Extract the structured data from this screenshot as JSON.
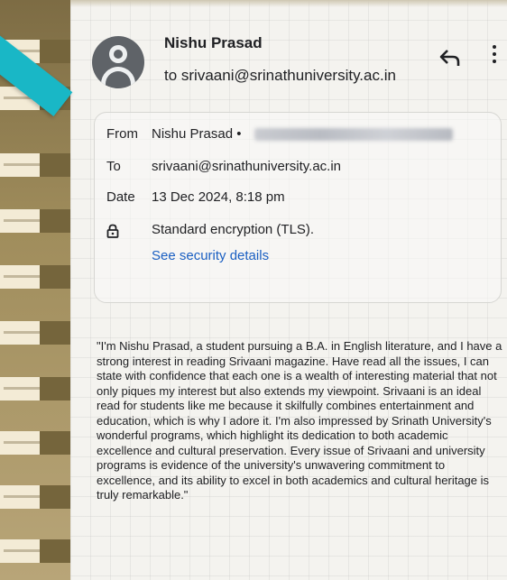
{
  "email": {
    "sender_name": "Nishu Prasad",
    "to_line": "to srivaani@srinathuniversity.ac.in",
    "details": {
      "from_label": "From",
      "from_value": "Nishu Prasad •",
      "to_label": "To",
      "to_value": "srivaani@srinathuniversity.ac.in",
      "date_label": "Date",
      "date_value": "13 Dec 2024, 8:18 pm",
      "encryption": "Standard encryption (TLS).",
      "security_link": "See security details"
    },
    "body": "\"I'm Nishu Prasad, a student pursuing a B.A. in English literature, and I have a strong interest in reading Srivaani magazine. Have read all the issues, I can state with confidence that each one is a wealth of interesting material that not only piques my interest but also extends my viewpoint. Srivaani is an ideal read for students like me because it skilfully combines entertainment and education, which is why I adore it. I'm also impressed by Srinath University's wonderful programs, which highlight its dedication to both academic excellence and cultural preservation. Every issue of Srivaani and university programs is evidence of the university's unwavering commitment to excellence, and its ability to excel in both academics and cultural heritage is truly remarkable.\""
  },
  "icons": {
    "avatar": "person-avatar-icon",
    "reply": "reply-icon",
    "more": "more-vert-icon",
    "lock": "lock-icon"
  },
  "colors": {
    "link": "#1a5fc2",
    "accent_ribbon": "#19b7c6",
    "avatar_bg": "#5f6368"
  }
}
